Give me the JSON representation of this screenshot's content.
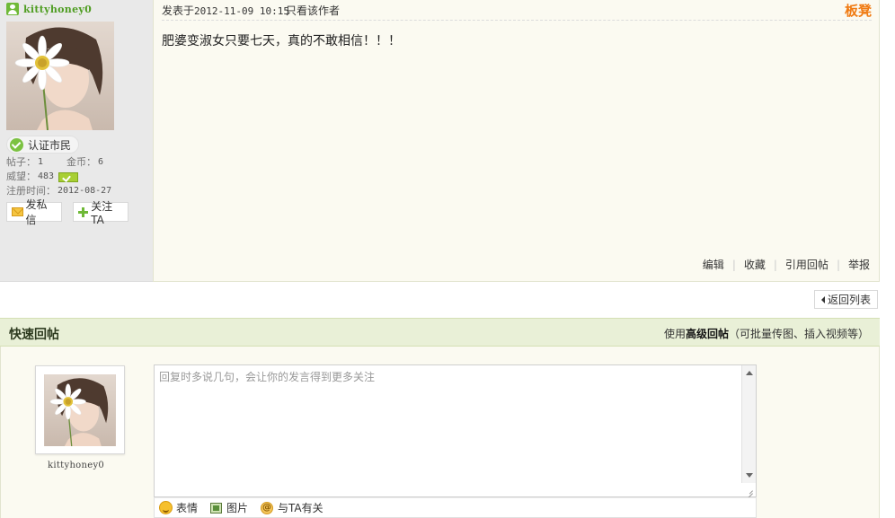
{
  "post": {
    "author": {
      "username": "kittyhoney0",
      "badge": "认证市民",
      "stats": {
        "posts_label": "帖子：",
        "posts_value": "1",
        "coins_label": "金币：",
        "coins_value": "6",
        "prestige_label": "威望：",
        "prestige_value": "483",
        "registered_label": "注册时间：",
        "registered_value": "2012-08-27"
      },
      "buttons": {
        "pm": "发私信",
        "follow": "关注TA"
      }
    },
    "header": {
      "posted_prefix": "发表于",
      "posted_time": "2012-11-09 10:15",
      "only_author": "只看该作者",
      "floor": "板凳"
    },
    "content": "肥婆变淑女只要七天，真的不敢相信！！！",
    "actions": [
      "编辑",
      "收藏",
      "引用回帖",
      "举报"
    ]
  },
  "return_list": "返回列表",
  "quick_reply": {
    "title": "快速回帖",
    "advanced_prefix": "使用",
    "advanced_link": "高级回帖",
    "advanced_suffix": "（可批量传图、插入视频等）",
    "username": "kittyhoney0",
    "textarea": {
      "placeholder": "回复时多说几句，会让你的发言得到更多关注",
      "value": ""
    },
    "tools": {
      "emoji": "表情",
      "image": "图片",
      "mention": "与TA有关"
    }
  },
  "colors": {
    "username_green": "#4f9d22",
    "floor_orange": "#f07a11",
    "reply_bar_bg": "#e9f0d7",
    "post_bg": "#fbfaf1"
  },
  "icons": {
    "user": "user-icon",
    "badge": "check-icon",
    "level": "level-icon",
    "pm": "mail-icon",
    "follow": "plus-icon",
    "return": "left-arrow-icon",
    "emoji": "smile-icon",
    "image": "image-icon",
    "mention": "at-icon"
  }
}
